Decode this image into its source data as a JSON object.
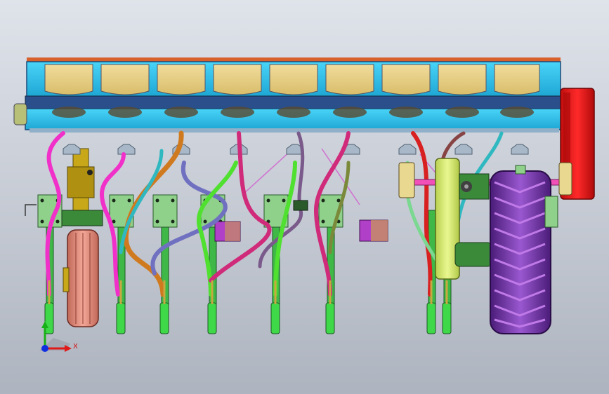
{
  "viewport": {
    "background_top": "#dfe3ea",
    "background_bottom": "#aeb4bf"
  },
  "triad": {
    "x_label": "X",
    "x_color": "#e01818",
    "y_color": "#18b018",
    "z_color": "#1030e0"
  },
  "machine": {
    "hopper_fill": "#e8d08a",
    "frame_fill": "#29c1ee",
    "frame_dark": "#2a4f8a",
    "top_strip": "#d8602a",
    "gearbox_fill": "#ee1c1c",
    "bracket_fill": "#8fd08a",
    "shank_fill": "#3fb848",
    "stand_fill": "#c8a818",
    "tire_front_fill": "#e89080",
    "tire_rear_fill": "#7a3aa8",
    "chain_guard_fill": "#d8f070",
    "hose_colors": [
      "#f030c8",
      "#d02a7a",
      "#d07a20",
      "#30b8c0",
      "#7070c0",
      "#50e030",
      "#606060",
      "#884488"
    ]
  }
}
